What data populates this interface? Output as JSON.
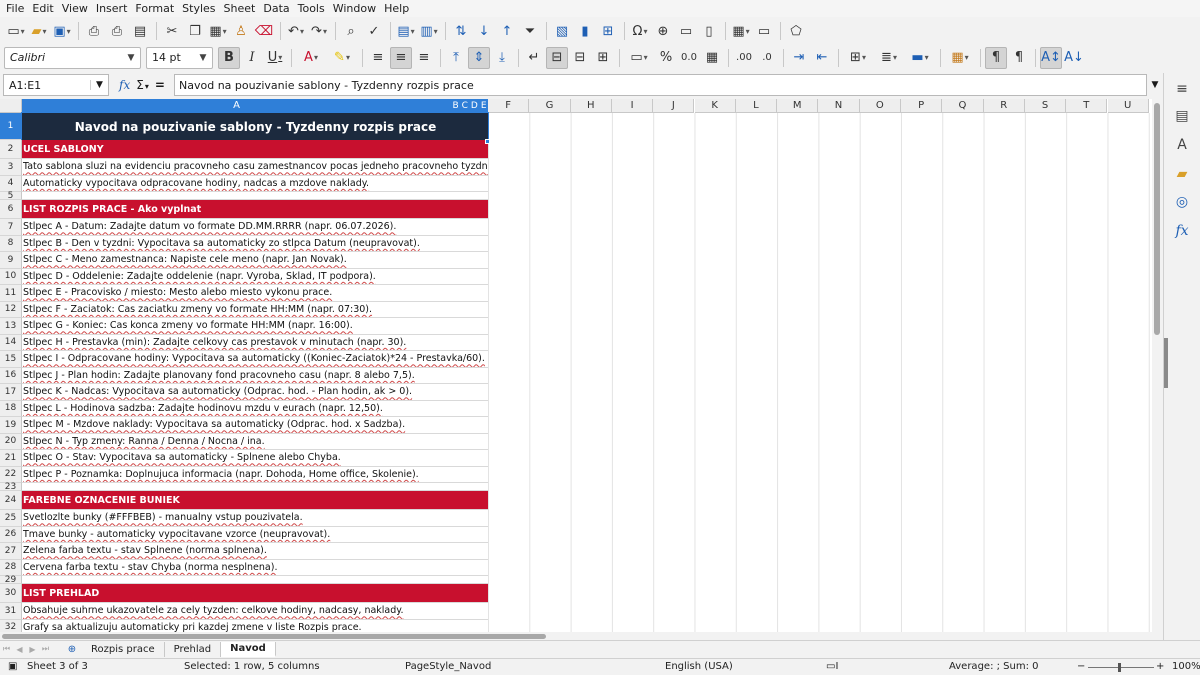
{
  "menu": [
    "File",
    "Edit",
    "View",
    "Insert",
    "Format",
    "Styles",
    "Sheet",
    "Data",
    "Tools",
    "Window",
    "Help"
  ],
  "toolbar": {
    "font_name": "Calibri",
    "font_size": "14 pt",
    "bold_label": "B",
    "italic_label": "I",
    "underline_label": "U",
    "percent_label": "%",
    "decimal_label": "0.0",
    "add_decimal_label": ".00",
    "remove_decimal_label": ".0"
  },
  "formula_bar": {
    "name_box": "A1:E1",
    "content": "Navod na pouzivanie sablony - Tyzdenny rozpis prace"
  },
  "columns": {
    "selected": "A",
    "selected_rest": [
      "B",
      "C",
      "D",
      "E"
    ],
    "others": [
      "F",
      "G",
      "H",
      "I",
      "J",
      "K",
      "L",
      "M",
      "N",
      "O",
      "P",
      "Q",
      "R",
      "S",
      "T",
      "U"
    ]
  },
  "rows": [
    {
      "n": "1",
      "text": "Navod na pouzivanie sablony - Tyzdenny rozpis prace",
      "kind": "title"
    },
    {
      "n": "2",
      "text": "UCEL SABLONY",
      "kind": "section"
    },
    {
      "n": "3",
      "text": "Tato sablona sluzi na evidenciu pracovneho casu zamestnancov pocas jedneho pracovneho tyzdna.",
      "kind": "body"
    },
    {
      "n": "4",
      "text": "Automaticky vypocitava odpracovane hodiny, nadcas a mzdove naklady.",
      "kind": "body"
    },
    {
      "n": "5",
      "text": "",
      "kind": "blank"
    },
    {
      "n": "6",
      "text": "LIST ROZPIS PRACE - Ako vyplnat",
      "kind": "section"
    },
    {
      "n": "7",
      "text": "Stlpec A - Datum: Zadajte datum vo formate DD.MM.RRRR (napr. 06.07.2026).",
      "kind": "body"
    },
    {
      "n": "8",
      "text": "Stlpec B - Den v tyzdni: Vypocitava sa automaticky zo stlpca Datum (neupravovat).",
      "kind": "body"
    },
    {
      "n": "9",
      "text": "Stlpec C - Meno zamestnanca: Napiste cele meno (napr. Jan Novak).",
      "kind": "body"
    },
    {
      "n": "10",
      "text": "Stlpec D - Oddelenie: Zadajte oddelenie (napr. Vyroba, Sklad, IT podpora).",
      "kind": "body"
    },
    {
      "n": "11",
      "text": "Stlpec E - Pracovisko / miesto: Mesto alebo miesto vykonu prace.",
      "kind": "body"
    },
    {
      "n": "12",
      "text": "Stlpec F - Zaciatok: Cas zaciatku zmeny vo formate HH:MM (napr. 07:30).",
      "kind": "body"
    },
    {
      "n": "13",
      "text": "Stlpec G - Koniec: Cas konca zmeny vo formate HH:MM (napr. 16:00).",
      "kind": "body"
    },
    {
      "n": "14",
      "text": "Stlpec H - Prestavka (min): Zadajte celkovy cas prestavok v minutach (napr. 30).",
      "kind": "body"
    },
    {
      "n": "15",
      "text": "Stlpec I - Odpracovane hodiny: Vypocitava sa automaticky ((Koniec-Zaciatok)*24 - Prestavka/60).",
      "kind": "body"
    },
    {
      "n": "16",
      "text": "Stlpec J - Plan hodin: Zadajte planovany fond pracovneho casu (napr. 8 alebo 7,5).",
      "kind": "body"
    },
    {
      "n": "17",
      "text": "Stlpec K - Nadcas: Vypocitava sa automaticky (Odprac. hod. - Plan hodin, ak > 0).",
      "kind": "body"
    },
    {
      "n": "18",
      "text": "Stlpec L - Hodinova sadzba: Zadajte hodinovu mzdu v eurach (napr. 12,50).",
      "kind": "body"
    },
    {
      "n": "19",
      "text": "Stlpec M - Mzdove naklady: Vypocitava sa automaticky (Odprac. hod. x Sadzba).",
      "kind": "body"
    },
    {
      "n": "20",
      "text": "Stlpec N - Typ zmeny: Ranna / Denna / Nocna / ina.",
      "kind": "body"
    },
    {
      "n": "21",
      "text": "Stlpec O - Stav: Vypocitava sa automaticky - Splnene alebo Chyba.",
      "kind": "body"
    },
    {
      "n": "22",
      "text": "Stlpec P - Poznamka: Doplnujuca informacia (napr. Dohoda, Home office, Skolenie).",
      "kind": "body"
    },
    {
      "n": "23",
      "text": "",
      "kind": "blank"
    },
    {
      "n": "24",
      "text": "FAREBNE OZNACENIE BUNIEK",
      "kind": "section"
    },
    {
      "n": "25",
      "text": "Svetlozlte bunky (#FFFBEB) - manualny vstup pouzivatela.",
      "kind": "body"
    },
    {
      "n": "26",
      "text": "Tmave bunky - automaticky vypocitavane vzorce (neupravovat).",
      "kind": "body"
    },
    {
      "n": "27",
      "text": "Zelena farba textu - stav Splnene (norma splnena).",
      "kind": "body"
    },
    {
      "n": "28",
      "text": "Cervena farba textu - stav Chyba (norma nesplnena).",
      "kind": "body"
    },
    {
      "n": "29",
      "text": "",
      "kind": "blank"
    },
    {
      "n": "30",
      "text": "LIST PREHLAD",
      "kind": "section"
    },
    {
      "n": "31",
      "text": "Obsahuje suhrne ukazovatele za cely tyzden: celkove hodiny, nadcasy, naklady.",
      "kind": "body"
    },
    {
      "n": "32",
      "text": "Grafy sa aktualizuju automaticky pri kazdej zmene v liste Rozpis prace.",
      "kind": "body"
    }
  ],
  "sheet_tabs": [
    "Rozpis prace",
    "Prehlad",
    "Navod"
  ],
  "active_tab": "Navod",
  "status": {
    "sheet": "Sheet 3 of 3",
    "selection": "Selected: 1 row, 5 columns",
    "page_style": "PageStyle_Navod",
    "language": "English (USA)",
    "sum": "Average: ; Sum: 0",
    "zoom": "100%"
  },
  "colors": {
    "title_bg": "#1c2a3e",
    "section_bg": "#c8102e",
    "selection": "#2f7fd8"
  }
}
